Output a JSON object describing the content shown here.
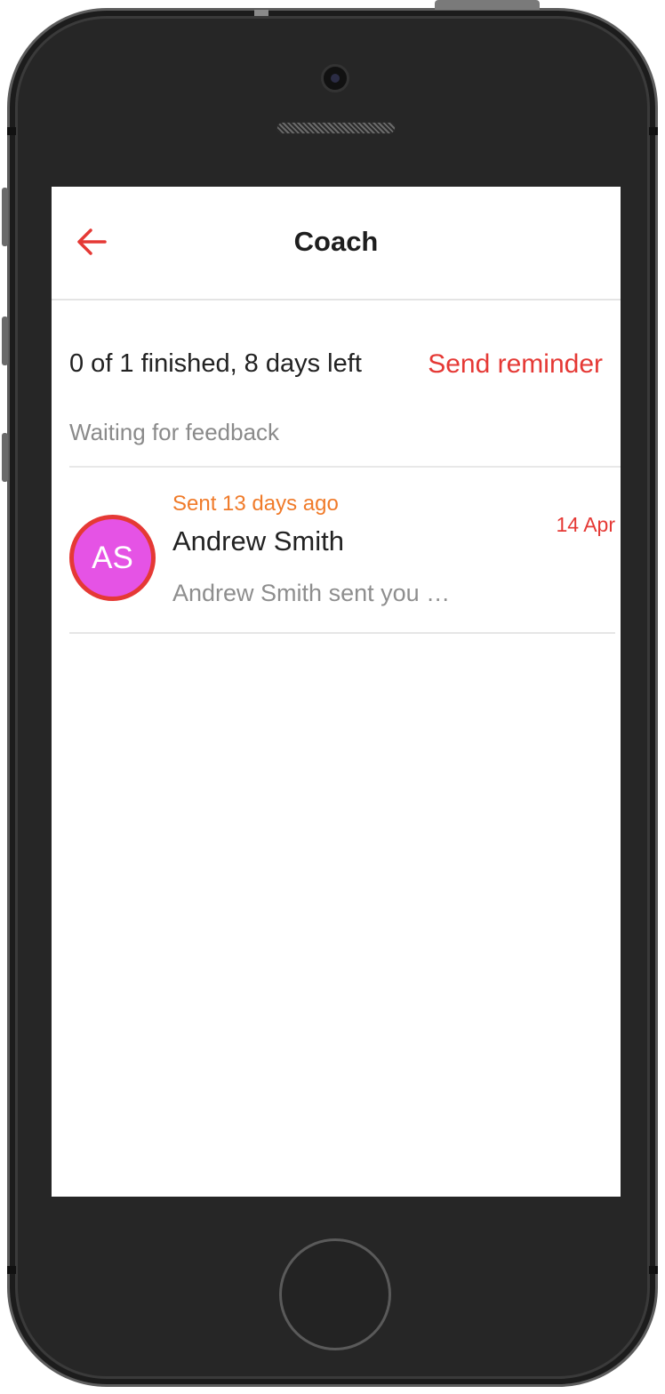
{
  "header": {
    "title": "Coach",
    "back_icon": "arrow-left-icon"
  },
  "summary": {
    "progress_text": "0 of 1 finished, 8 days left",
    "send_reminder_label": "Send reminder"
  },
  "section": {
    "label": "Waiting for feedback"
  },
  "items": [
    {
      "initials": "AS",
      "sent_time": "Sent 13 days ago",
      "name": "Andrew Smith",
      "date": "14 Apr",
      "preview": "Andrew Smith sent you …"
    }
  ],
  "colors": {
    "accent": "#e53935",
    "sent_time": "#f07b2a",
    "avatar_fill": "#e553e5",
    "muted_text": "#8a8a8a"
  }
}
